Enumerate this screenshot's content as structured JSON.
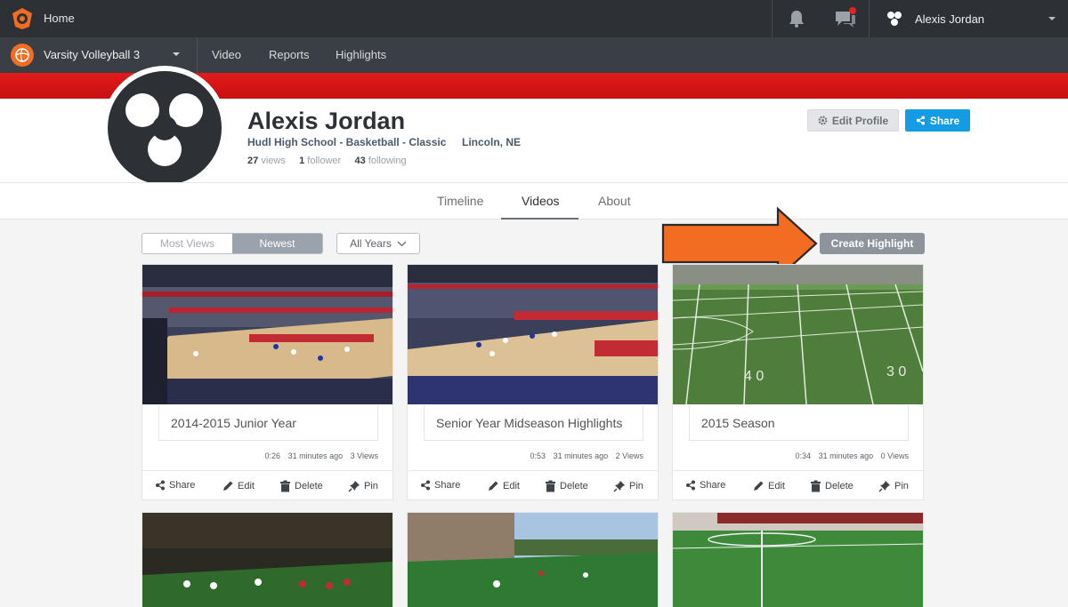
{
  "topbar": {
    "home_label": "Home",
    "user_name": "Alexis Jordan",
    "icons": [
      "hudl-logo-icon",
      "bell-icon",
      "chat-icon",
      "user-avatar-icon",
      "caret-down-icon"
    ],
    "notification_dot_color": "#e02424"
  },
  "teambar": {
    "team_name": "Varsity Volleyball 3",
    "nav": [
      "Video",
      "Reports",
      "Highlights"
    ],
    "accent": "#f26c21"
  },
  "banner_color": "#d41414",
  "profile": {
    "name": "Alexis Jordan",
    "school": "Hudl High School - Basketball - Classic",
    "location": "Lincoln, NE",
    "views_count": "27",
    "views_label": "views",
    "followers_count": "1",
    "followers_label": "follower",
    "following_count": "43",
    "following_label": "following",
    "edit_label": "Edit Profile",
    "share_label": "Share"
  },
  "tabs": {
    "timeline": "Timeline",
    "videos": "Videos",
    "about": "About",
    "active": "Videos"
  },
  "filters": {
    "most_views": "Most Views",
    "newest": "Newest",
    "years": "All Years",
    "create_highlight": "Create Highlight"
  },
  "cards": [
    {
      "title": "2014-2015 Junior Year",
      "duration": "0:26",
      "time": "31 minutes ago",
      "views": "3 Views",
      "scene": "basketball"
    },
    {
      "title": "Senior Year Midseason Highlights",
      "duration": "0:53",
      "time": "31 minutes ago",
      "views": "2 Views",
      "scene": "basketball"
    },
    {
      "title": "2015 Season",
      "duration": "0:34",
      "time": "31 minutes ago",
      "views": "0 Views",
      "scene": "football"
    }
  ],
  "actions": {
    "share": "Share",
    "edit": "Edit",
    "delete": "Delete",
    "pin": "Pin"
  },
  "arrow_color": "#f26c21"
}
